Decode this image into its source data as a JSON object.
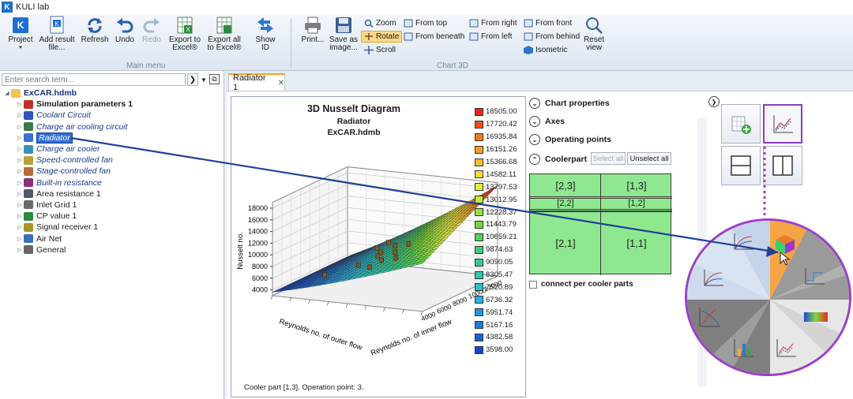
{
  "app": {
    "title": "KULI lab",
    "logo": "K"
  },
  "ribbon": {
    "main_group_label": "Main menu",
    "chart_group_label": "Chart 3D",
    "buttons": {
      "project": "Project",
      "add_result": "Add result file...",
      "refresh": "Refresh",
      "undo": "Undo",
      "redo": "Redo",
      "export_to_excel": "Export to Excel®",
      "export_all": "Export all to Excel®",
      "show_id": "Show ID",
      "print": "Print...",
      "save_as_image": "Save as image...",
      "reset_view": "Reset view"
    },
    "view_controls": {
      "zoom": "Zoom",
      "rotate": "Rotate",
      "scroll": "Scroll",
      "from_top": "From top",
      "from_beneath": "From beneath",
      "from_right": "From right",
      "from_left": "From left",
      "from_front": "From front",
      "from_behind": "From behind",
      "isometric": "Isometric"
    }
  },
  "search": {
    "placeholder": "Enter search term..."
  },
  "tree": {
    "root": "ExCAR.hdmb",
    "items": [
      {
        "label": "Simulation parameters 1",
        "style": "bold",
        "color": "#c0302b"
      },
      {
        "label": "Coolant Circuit",
        "style": "italic",
        "color": "#2f55b8"
      },
      {
        "label": "Charge air cooling circuit",
        "style": "italic",
        "color": "#3b7a4a"
      },
      {
        "label": "Radiator",
        "style": "selected",
        "color": "#3d6fcf"
      },
      {
        "label": "Charge air cooler",
        "style": "italic",
        "color": "#3c8fb8"
      },
      {
        "label": "Speed-controlled fan",
        "style": "italic",
        "color": "#b8a23a"
      },
      {
        "label": "Stage-controlled fan",
        "style": "italic",
        "color": "#b86a3a"
      },
      {
        "label": "Built-in resistance",
        "style": "italic",
        "color": "#8b2f7a"
      },
      {
        "label": "Area resistance 1",
        "style": "normal",
        "color": "#4a5a6a"
      },
      {
        "label": "Inlet Grid 1",
        "style": "normal",
        "color": "#6a6a6a"
      },
      {
        "label": "CP value 1",
        "style": "normal",
        "color": "#2b8a3f"
      },
      {
        "label": "Signal receiver 1",
        "style": "normal",
        "color": "#a8932a"
      },
      {
        "label": "Air Net",
        "style": "normal",
        "color": "#3b6fb8"
      },
      {
        "label": "General",
        "style": "normal",
        "color": "#666666"
      }
    ]
  },
  "doc_tab": {
    "label": "Radiator 1"
  },
  "chart": {
    "title": "3D Nusselt Diagram",
    "subtitle1": "Radiator",
    "subtitle2": "ExCAR.hdmb",
    "z_label": "Nusselt no.",
    "x_label": "Reynolds no. of outer flow",
    "y_label": "Reynolds no. of inner flow",
    "z_ticks": [
      "4000",
      "6000",
      "8000",
      "10000",
      "12000",
      "14000",
      "16000",
      "18000"
    ],
    "inner_ticks": [
      "4000",
      "6000",
      "8000",
      "10000",
      "12000"
    ],
    "status": "Cooler part [1,3]. Operation point: 3."
  },
  "legend": [
    {
      "value": "18505.00",
      "color": "#e52a1c"
    },
    {
      "value": "17720.42",
      "color": "#ec5418"
    },
    {
      "value": "16935.84",
      "color": "#f2791a"
    },
    {
      "value": "16151.26",
      "color": "#f59d22"
    },
    {
      "value": "15366.68",
      "color": "#f4be2c"
    },
    {
      "value": "14582.11",
      "color": "#f1dc37"
    },
    {
      "value": "13797.53",
      "color": "#e2ef3d"
    },
    {
      "value": "13012.95",
      "color": "#c0eb3b"
    },
    {
      "value": "12228.37",
      "color": "#97e23a"
    },
    {
      "value": "11443.79",
      "color": "#6ed93d"
    },
    {
      "value": "10659.21",
      "color": "#4fd15a"
    },
    {
      "value": "9874.63",
      "color": "#3bcd7a"
    },
    {
      "value": "9090.05",
      "color": "#32cb98"
    },
    {
      "value": "8305.47",
      "color": "#2ec8b4"
    },
    {
      "value": "7520.89",
      "color": "#2bc2ce"
    },
    {
      "value": "6736.32",
      "color": "#27b2de"
    },
    {
      "value": "5951.74",
      "color": "#2299e0"
    },
    {
      "value": "5167.16",
      "color": "#1c7ddd"
    },
    {
      "value": "4382.58",
      "color": "#1862d8"
    },
    {
      "value": "3598.00",
      "color": "#1448d2"
    }
  ],
  "properties": {
    "chart_properties": "Chart properties",
    "axes": "Axes",
    "operating_points": "Operating points",
    "coolerpart": "Coolerpart",
    "select_all": "Select all",
    "unselect_all": "Unselect all",
    "connect": "connect per cooler parts",
    "cells": {
      "c23": "[2,3]",
      "c13": "[1,3]",
      "c22": "[2,2]",
      "c12": "[1,2]",
      "c21": "[2,1]",
      "c11": "[1,1]"
    }
  },
  "colors": {
    "accent": "#9b3fcc",
    "arrow": "#1f3f9a",
    "grid_green": "#8fe88f",
    "tab_highlight": "#f4a11f"
  }
}
